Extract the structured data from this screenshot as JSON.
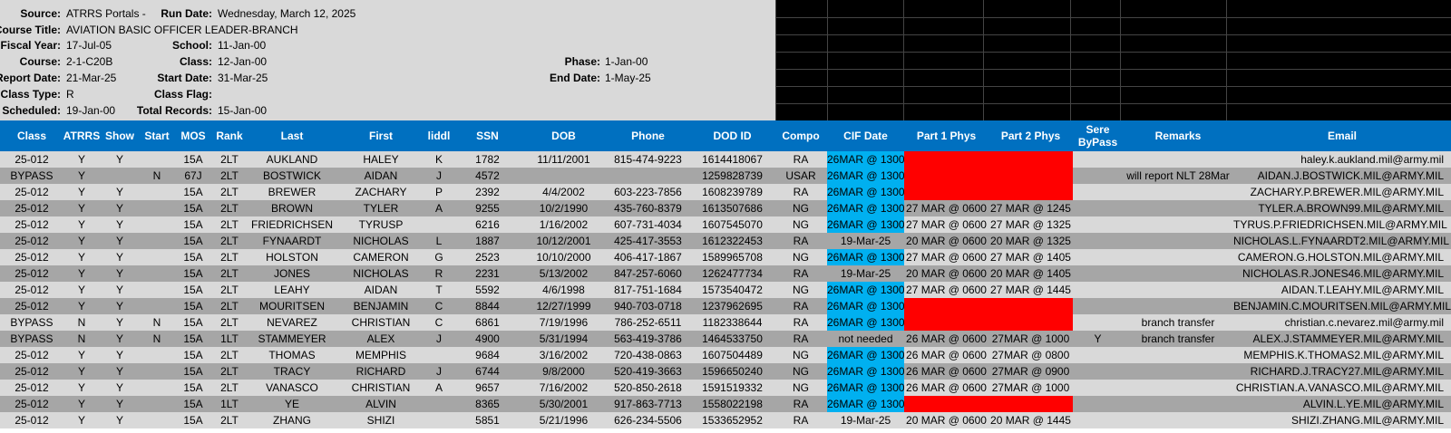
{
  "header": {
    "source_label": "Source:",
    "source_value": "ATRRS Portals -",
    "run_date_label": "Run Date:",
    "run_date_value": "Wednesday, March 12, 2025",
    "course_title_label": "Course Title:",
    "course_title_value": "AVIATION BASIC OFFICER LEADER-BRANCH",
    "fiscal_year_label": "Fiscal Year:",
    "fiscal_year_value": "17-Jul-05",
    "school_label": "School:",
    "school_value": "11-Jan-00",
    "course_label": "Course:",
    "course_value": "2-1-C20B",
    "class_label": "Class:",
    "class_value": "12-Jan-00",
    "phase_label": "Phase:",
    "phase_value": "1-Jan-00",
    "report_date_label": "Report Date:",
    "report_date_value": "21-Mar-25",
    "start_date_label": "Start Date:",
    "start_date_value": "31-Mar-25",
    "end_date_label": "End Date:",
    "end_date_value": "1-May-25",
    "class_type_label": "Class Type:",
    "class_type_value": "R",
    "class_flag_label": "Class Flag:",
    "class_flag_value": "",
    "scheduled_label": "Scheduled:",
    "scheduled_value": "19-Jan-00",
    "total_records_label": "Total Records:",
    "total_records_value": "15-Jan-00"
  },
  "columns": [
    "Class",
    "ATRRS",
    "Show",
    "Start",
    "MOS",
    "Rank",
    "Last",
    "First",
    "liddl",
    "SSN",
    "DOB",
    "Phone",
    "DOD ID",
    "Compo",
    "CIF Date",
    "Part 1 Phys",
    "Part 2 Phys",
    "Sere\nByPass",
    "Remarks",
    "Email"
  ],
  "colors": {
    "header_blue": "#0070c0",
    "cif_blue": "#00b0f0",
    "phys_red": "#ff0000",
    "row_light": "#d9d9d9",
    "row_dark": "#a6a6a6"
  },
  "rows": [
    {
      "class": "25-012",
      "atrrs": "Y",
      "show": "Y",
      "start": "",
      "mos": "15A",
      "rank": "2LT",
      "last": "AUKLAND",
      "first": "HALEY",
      "mi": "K",
      "ssn": "1782",
      "dob": "11/11/2001",
      "phone": "815-474-9223",
      "dodid": "1614418067",
      "compo": "RA",
      "cif": "26MAR @ 1300",
      "cif_blue": true,
      "p1": "",
      "p2": "",
      "phys_red": true,
      "sere": "",
      "remarks": "",
      "email": "haley.k.aukland.mil@army.mil"
    },
    {
      "class": "BYPASS",
      "atrrs": "Y",
      "show": "",
      "start": "N",
      "mos": "67J",
      "rank": "2LT",
      "last": "BOSTWICK",
      "first": "AIDAN",
      "mi": "J",
      "ssn": "4572",
      "dob": "",
      "phone": "",
      "dodid": "1259828739",
      "compo": "USAR",
      "cif": "26MAR @ 1300",
      "cif_blue": true,
      "p1": "",
      "p2": "",
      "phys_red": true,
      "sere": "",
      "remarks": "will report NLT 28Mar",
      "email": "AIDAN.J.BOSTWICK.MIL@ARMY.MIL"
    },
    {
      "class": "25-012",
      "atrrs": "Y",
      "show": "Y",
      "start": "",
      "mos": "15A",
      "rank": "2LT",
      "last": "BREWER",
      "first": "ZACHARY",
      "mi": "P",
      "ssn": "2392",
      "dob": "4/4/2002",
      "phone": "603-223-7856",
      "dodid": "1608239789",
      "compo": "RA",
      "cif": "26MAR @ 1300",
      "cif_blue": true,
      "p1": "",
      "p2": "",
      "phys_red": true,
      "sere": "",
      "remarks": "",
      "email": "ZACHARY.P.BREWER.MIL@ARMY.MIL"
    },
    {
      "class": "25-012",
      "atrrs": "Y",
      "show": "Y",
      "start": "",
      "mos": "15A",
      "rank": "2LT",
      "last": "BROWN",
      "first": "TYLER",
      "mi": "A",
      "ssn": "9255",
      "dob": "10/2/1990",
      "phone": "435-760-8379",
      "dodid": "1613507686",
      "compo": "NG",
      "cif": "26MAR @ 1300",
      "cif_blue": true,
      "p1": "27 MAR @ 0600",
      "p2": "27 MAR @ 1245",
      "phys_red": false,
      "sere": "",
      "remarks": "",
      "email": "TYLER.A.BROWN99.MIL@ARMY.MIL"
    },
    {
      "class": "25-012",
      "atrrs": "Y",
      "show": "Y",
      "start": "",
      "mos": "15A",
      "rank": "2LT",
      "last": "FRIEDRICHSEN",
      "first": "TYRUSP",
      "mi": "",
      "ssn": "6216",
      "dob": "1/16/2002",
      "phone": "607-731-4034",
      "dodid": "1607545070",
      "compo": "NG",
      "cif": "26MAR @ 1300",
      "cif_blue": true,
      "p1": "27 MAR @ 0600",
      "p2": "27 MAR @ 1325",
      "phys_red": false,
      "sere": "",
      "remarks": "",
      "email": "TYRUS.P.FRIEDRICHSEN.MIL@ARMY.MIL"
    },
    {
      "class": "25-012",
      "atrrs": "Y",
      "show": "Y",
      "start": "",
      "mos": "15A",
      "rank": "2LT",
      "last": "FYNAARDT",
      "first": "NICHOLAS",
      "mi": "L",
      "ssn": "1887",
      "dob": "10/12/2001",
      "phone": "425-417-3553",
      "dodid": "1612322453",
      "compo": "RA",
      "cif": "19-Mar-25",
      "cif_blue": false,
      "p1": "20 MAR @ 0600",
      "p2": "20 MAR @ 1325",
      "phys_red": false,
      "sere": "",
      "remarks": "",
      "email": "NICHOLAS.L.FYNAARDT2.MIL@ARMY.MIL"
    },
    {
      "class": "25-012",
      "atrrs": "Y",
      "show": "Y",
      "start": "",
      "mos": "15A",
      "rank": "2LT",
      "last": "HOLSTON",
      "first": "CAMERON",
      "mi": "G",
      "ssn": "2523",
      "dob": "10/10/2000",
      "phone": "406-417-1867",
      "dodid": "1589965708",
      "compo": "NG",
      "cif": "26MAR @ 1300",
      "cif_blue": true,
      "p1": "27 MAR @ 0600",
      "p2": "27 MAR @ 1405",
      "phys_red": false,
      "sere": "",
      "remarks": "",
      "email": "CAMERON.G.HOLSTON.MIL@ARMY.MIL"
    },
    {
      "class": "25-012",
      "atrrs": "Y",
      "show": "Y",
      "start": "",
      "mos": "15A",
      "rank": "2LT",
      "last": "JONES",
      "first": "NICHOLAS",
      "mi": "R",
      "ssn": "2231",
      "dob": "5/13/2002",
      "phone": "847-257-6060",
      "dodid": "1262477734",
      "compo": "RA",
      "cif": "19-Mar-25",
      "cif_blue": false,
      "p1": "20 MAR @ 0600",
      "p2": "20 MAR @ 1405",
      "phys_red": false,
      "sere": "",
      "remarks": "",
      "email": "NICHOLAS.R.JONES46.MIL@ARMY.MIL"
    },
    {
      "class": "25-012",
      "atrrs": "Y",
      "show": "Y",
      "start": "",
      "mos": "15A",
      "rank": "2LT",
      "last": "LEAHY",
      "first": "AIDAN",
      "mi": "T",
      "ssn": "5592",
      "dob": "4/6/1998",
      "phone": "817-751-1684",
      "dodid": "1573540472",
      "compo": "NG",
      "cif": "26MAR @ 1300",
      "cif_blue": true,
      "p1": "27 MAR @ 0600",
      "p2": "27 MAR @ 1445",
      "phys_red": false,
      "sere": "",
      "remarks": "",
      "email": "AIDAN.T.LEAHY.MIL@ARMY.MIL"
    },
    {
      "class": "25-012",
      "atrrs": "Y",
      "show": "Y",
      "start": "",
      "mos": "15A",
      "rank": "2LT",
      "last": "MOURITSEN",
      "first": "BENJAMIN",
      "mi": "C",
      "ssn": "8844",
      "dob": "12/27/1999",
      "phone": "940-703-0718",
      "dodid": "1237962695",
      "compo": "RA",
      "cif": "26MAR @ 1300",
      "cif_blue": true,
      "p1": "",
      "p2": "",
      "phys_red": true,
      "sere": "",
      "remarks": "",
      "email": "BENJAMIN.C.MOURITSEN.MIL@ARMY.MIL"
    },
    {
      "class": "BYPASS",
      "atrrs": "N",
      "show": "Y",
      "start": "N",
      "mos": "15A",
      "rank": "2LT",
      "last": "NEVAREZ",
      "first": "CHRISTIAN",
      "mi": "C",
      "ssn": "6861",
      "dob": "7/19/1996",
      "phone": "786-252-6511",
      "dodid": "1182338644",
      "compo": "RA",
      "cif": "26MAR @ 1300",
      "cif_blue": true,
      "p1": "",
      "p2": "",
      "phys_red": true,
      "sere": "",
      "remarks": "branch transfer",
      "email": "christian.c.nevarez.mil@army.mil"
    },
    {
      "class": "BYPASS",
      "atrrs": "N",
      "show": "Y",
      "start": "N",
      "mos": "15A",
      "rank": "1LT",
      "last": "STAMMEYER",
      "first": "ALEX",
      "mi": "J",
      "ssn": "4900",
      "dob": "5/31/1994",
      "phone": "563-419-3786",
      "dodid": "1464533750",
      "compo": "RA",
      "cif": "not needed",
      "cif_blue": false,
      "p1": "26 MAR @ 0600",
      "p2": "27MAR @ 1000",
      "phys_red": false,
      "sere": "Y",
      "remarks": "branch transfer",
      "email": "ALEX.J.STAMMEYER.MIL@ARMY.MIL"
    },
    {
      "class": "25-012",
      "atrrs": "Y",
      "show": "Y",
      "start": "",
      "mos": "15A",
      "rank": "2LT",
      "last": "THOMAS",
      "first": "MEMPHIS",
      "mi": "",
      "ssn": "9684",
      "dob": "3/16/2002",
      "phone": "720-438-0863",
      "dodid": "1607504489",
      "compo": "NG",
      "cif": "26MAR @ 1300",
      "cif_blue": true,
      "p1": "26 MAR @ 0600",
      "p2": "27MAR @ 0800",
      "phys_red": false,
      "sere": "",
      "remarks": "",
      "email": "MEMPHIS.K.THOMAS2.MIL@ARMY.MIL"
    },
    {
      "class": "25-012",
      "atrrs": "Y",
      "show": "Y",
      "start": "",
      "mos": "15A",
      "rank": "2LT",
      "last": "TRACY",
      "first": "RICHARD",
      "mi": "J",
      "ssn": "6744",
      "dob": "9/8/2000",
      "phone": "520-419-3663",
      "dodid": "1596650240",
      "compo": "NG",
      "cif": "26MAR @ 1300",
      "cif_blue": true,
      "p1": "26 MAR @ 0600",
      "p2": "27MAR @ 0900",
      "phys_red": false,
      "sere": "",
      "remarks": "",
      "email": "RICHARD.J.TRACY27.MIL@ARMY.MIL"
    },
    {
      "class": "25-012",
      "atrrs": "Y",
      "show": "Y",
      "start": "",
      "mos": "15A",
      "rank": "2LT",
      "last": "VANASCO",
      "first": "CHRISTIAN",
      "mi": "A",
      "ssn": "9657",
      "dob": "7/16/2002",
      "phone": "520-850-2618",
      "dodid": "1591519332",
      "compo": "NG",
      "cif": "26MAR @ 1300",
      "cif_blue": true,
      "p1": "26 MAR @ 0600",
      "p2": "27MAR @ 1000",
      "phys_red": false,
      "sere": "",
      "remarks": "",
      "email": "CHRISTIAN.A.VANASCO.MIL@ARMY.MIL"
    },
    {
      "class": "25-012",
      "atrrs": "Y",
      "show": "Y",
      "start": "",
      "mos": "15A",
      "rank": "1LT",
      "last": "YE",
      "first": "ALVIN",
      "mi": "",
      "ssn": "8365",
      "dob": "5/30/2001",
      "phone": "917-863-7713",
      "dodid": "1558022198",
      "compo": "RA",
      "cif": "26MAR @ 1300",
      "cif_blue": true,
      "p1": "",
      "p2": "",
      "phys_red": true,
      "sere": "",
      "remarks": "",
      "email": "ALVIN.L.YE.MIL@ARMY.MIL"
    },
    {
      "class": "25-012",
      "atrrs": "Y",
      "show": "Y",
      "start": "",
      "mos": "15A",
      "rank": "2LT",
      "last": "ZHANG",
      "first": "SHIZI",
      "mi": "",
      "ssn": "5851",
      "dob": "5/21/1996",
      "phone": "626-234-5506",
      "dodid": "1533652952",
      "compo": "RA",
      "cif": "19-Mar-25",
      "cif_blue": false,
      "p1": "20 MAR @ 0600",
      "p2": "20 MAR @ 1445",
      "phys_red": false,
      "sere": "",
      "remarks": "",
      "email": "SHIZI.ZHANG.MIL@ARMY.MIL"
    }
  ]
}
